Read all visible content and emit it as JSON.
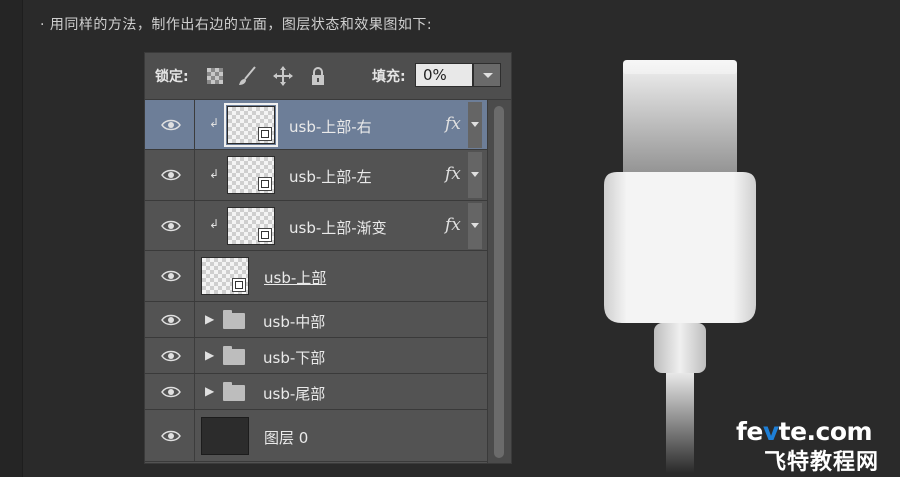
{
  "caption": "· 用同样的方法，制作出右边的立面，图层状态和效果图如下:",
  "layers_panel": {
    "lock_label": "锁定:",
    "fill_label": "填充:",
    "fill_value": "0%",
    "layers": [
      {
        "name": "usb-上部-右",
        "selected": true,
        "clipped": true,
        "fx": "fx",
        "type": "smart"
      },
      {
        "name": "usb-上部-左",
        "selected": false,
        "clipped": true,
        "fx": "fx",
        "type": "smart"
      },
      {
        "name": "usb-上部-渐变",
        "selected": false,
        "clipped": true,
        "fx": "fx",
        "type": "smart"
      },
      {
        "name": "usb-上部",
        "selected": false,
        "clipped": false,
        "fx": "",
        "type": "smart",
        "underline": true
      },
      {
        "name": "usb-中部",
        "type": "group"
      },
      {
        "name": "usb-下部",
        "type": "group"
      },
      {
        "name": "usb-尾部",
        "type": "group"
      },
      {
        "name": "图层 0",
        "type": "fill"
      }
    ]
  },
  "watermark": {
    "line1_a": "fe",
    "line1_b": "v",
    "line1_c": "te.com",
    "line2": "飞特教程网"
  },
  "colors": {
    "background": "#2a2a2a",
    "panel": "#535353",
    "selected_row": "#6d7e98",
    "watermark_accent": "#1e7fd6"
  }
}
